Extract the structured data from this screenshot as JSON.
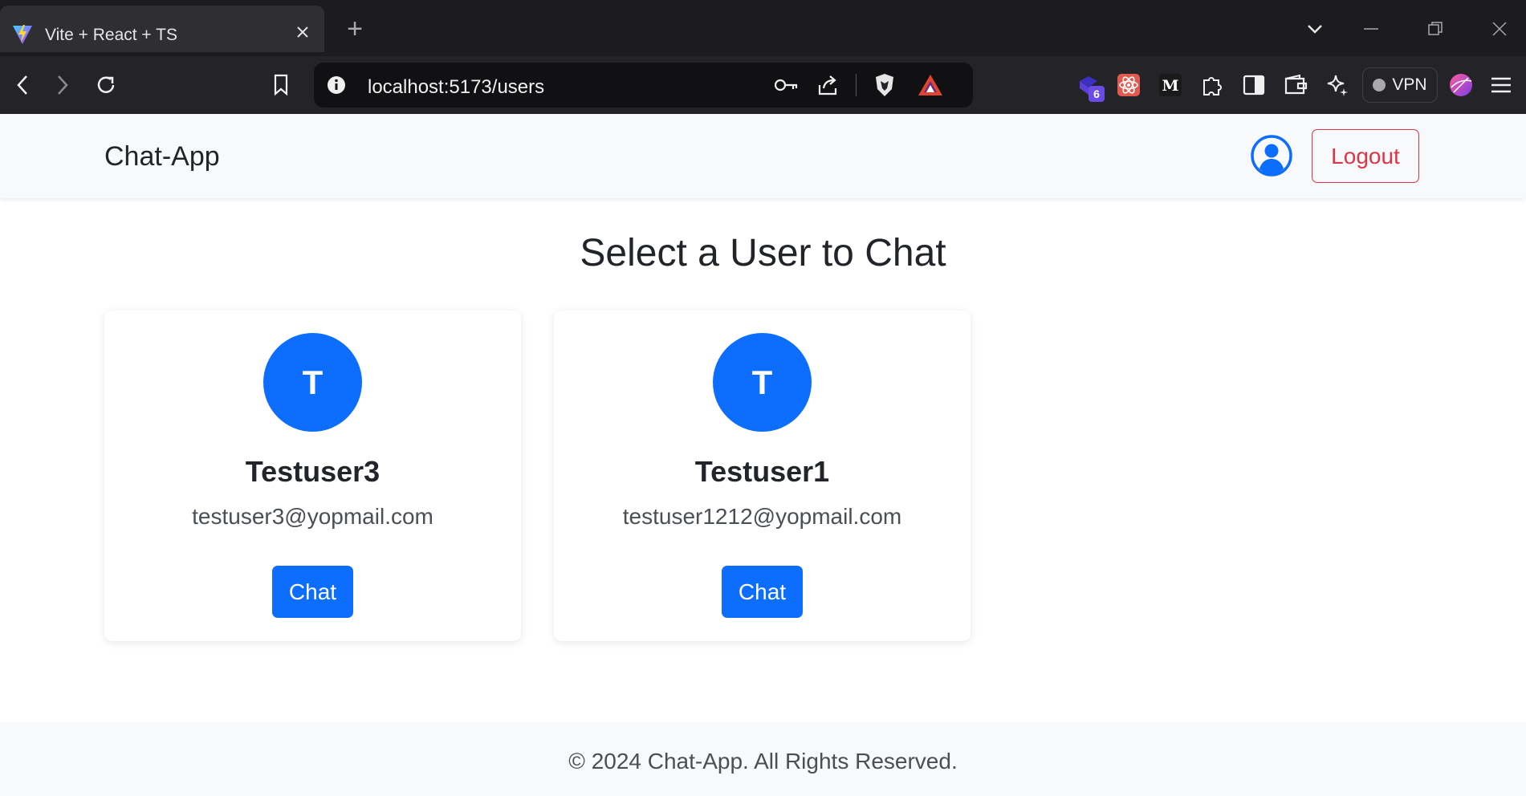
{
  "browser": {
    "tab_title": "Vite + React + TS",
    "tab_close_icon": "close-icon",
    "new_tab_label": "+",
    "url": "localhost:5173/users",
    "vpn_label": "VPN",
    "extension_badge_count": "6"
  },
  "navbar": {
    "brand": "Chat-App",
    "logout_label": "Logout"
  },
  "main": {
    "title": "Select a User to Chat",
    "users": [
      {
        "initial": "T",
        "name": "Testuser3",
        "email": "testuser3@yopmail.com",
        "button_label": "Chat"
      },
      {
        "initial": "T",
        "name": "Testuser1",
        "email": "testuser1212@yopmail.com",
        "button_label": "Chat"
      }
    ]
  },
  "footer": {
    "text": "© 2024 Chat-App. All Rights Reserved."
  },
  "colors": {
    "primary": "#0d6efd",
    "danger": "#dc3545",
    "navbar_bg": "#f8f9fa",
    "browser_tabbar": "#1c1c1f",
    "browser_toolbar": "#242428"
  }
}
